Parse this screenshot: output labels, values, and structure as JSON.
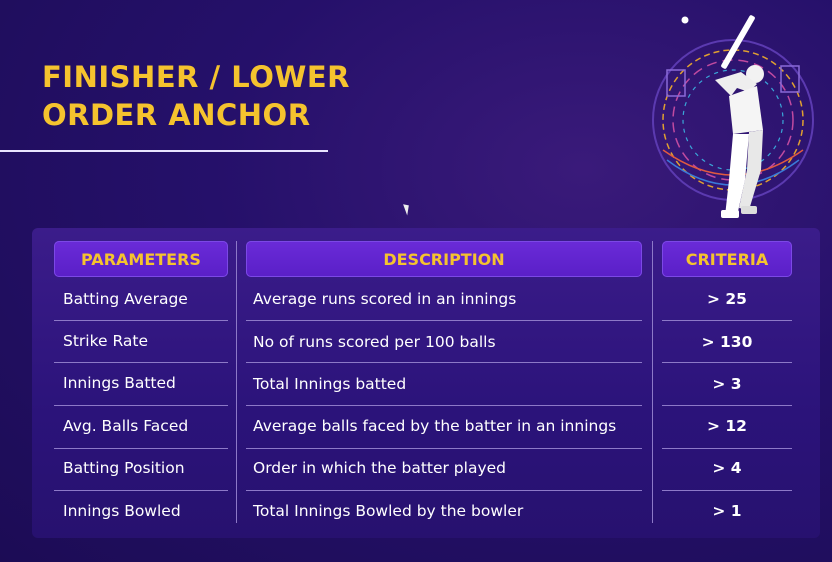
{
  "title": {
    "line1": "FINISHER / LOWER",
    "line2": "ORDER ANCHOR"
  },
  "table": {
    "headers": [
      "PARAMETERS",
      "DESCRIPTION",
      "CRITERIA"
    ],
    "rows": [
      {
        "parameter": "Batting Average",
        "description": "Average runs scored in an innings",
        "criteria": "> 25"
      },
      {
        "parameter": "Strike Rate",
        "description": "No of runs scored per 100 balls",
        "criteria": "> 130"
      },
      {
        "parameter": "Innings Batted",
        "description": "Total Innings batted",
        "criteria": "> 3"
      },
      {
        "parameter": "Avg. Balls Faced",
        "description": "Average balls faced by the batter in an innings",
        "criteria": "> 12"
      },
      {
        "parameter": "Batting Position",
        "description": "Order in which the batter played",
        "criteria": "> 4"
      },
      {
        "parameter": "Innings Bowled",
        "description": "Total Innings Bowled by the bowler",
        "criteria": "> 1"
      }
    ]
  },
  "colors": {
    "accent": "#f5c32e",
    "background": "#25106a",
    "header_fill": "#6a2bd8"
  },
  "icons": [
    "cricket-batter-illustration",
    "mouse-cursor-icon"
  ]
}
